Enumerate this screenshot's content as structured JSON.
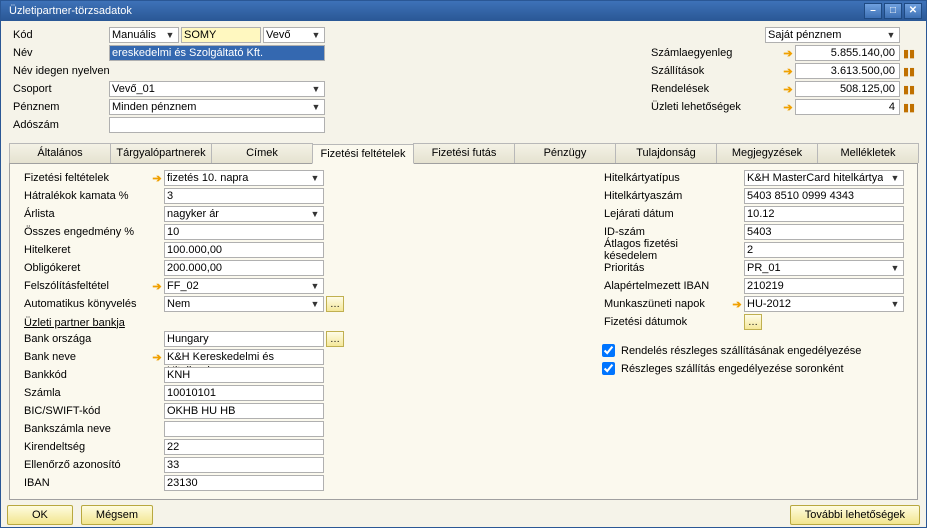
{
  "window": {
    "title": "Üzletipartner-törzsadatok"
  },
  "header": {
    "kod_label": "Kód",
    "kod_mode": "Manuális",
    "kod_value": "SOMY",
    "partner_type": "Vevő",
    "nev_label": "Név",
    "nev_value": "ereskedelmi és Szolgáltató Kft.",
    "nev_idegen_label": "Név idegen nyelven",
    "nev_idegen_value": "",
    "csoport_label": "Csoport",
    "csoport_value": "Vevő_01",
    "penznem_label": "Pénznem",
    "penznem_value": "Minden pénznem",
    "adoszam_label": "Adószám",
    "adoszam_value": ""
  },
  "summary": {
    "currency": "Saját pénznem",
    "egyenleg_label": "Számlaegyenleg",
    "egyenleg": "5.855.140,00",
    "szallitasok_label": "Szállítások",
    "szallitasok": "3.613.500,00",
    "rendelesek_label": "Rendelések",
    "rendelesek": "508.125,00",
    "uzleti_label": "Üzleti lehetőségek",
    "uzleti": "4"
  },
  "tabs": {
    "altalanos": "Általános",
    "targyalopartnerek": "Tárgyalópartnerek",
    "cimek": "Címek",
    "fizetesi_feltetelek": "Fizetési feltételek",
    "fizetesi_futas": "Fizetési futás",
    "penzugy": "Pénzügy",
    "tulajdonsag": "Tulajdonság",
    "megjegyzesek": "Megjegyzések",
    "mellekletek": "Mellékletek"
  },
  "left": {
    "fizetesi_feltetelek_label": "Fizetési feltételek",
    "fizetesi_feltetelek": "fizetés 10. napra",
    "hatralekokkamata_label": "Hátralékok kamata %",
    "hatralekokkamata": "3",
    "arlista_label": "Árlista",
    "arlista": "nagyker ár",
    "osszes_engedmenyes_label": "Összes engedmény %",
    "osszes_engedmenyes": "10",
    "hitelkeret_label": "Hitelkeret",
    "hitelkeret": "100.000,00",
    "obligokeret_label": "Obligókeret",
    "obligokeret": "200.000,00",
    "felszolitasfeltetel_label": "Felszólításfeltétel",
    "felszolitasfeltetel": "FF_02",
    "auto_konyveles_label": "Automatikus könyvelés",
    "auto_konyveles": "Nem",
    "section_bank": "Üzleti partner bankja",
    "bank_orszaga_label": "Bank országa",
    "bank_orszaga": "Hungary",
    "bank_neve_label": "Bank neve",
    "bank_neve": "K&H Kereskedelmi és Hitelbank",
    "bankkod_label": "Bankkód",
    "bankkod": "KNH",
    "szamla_label": "Számla",
    "szamla": "10010101",
    "bic_label": "BIC/SWIFT-kód",
    "bic": "OKHB HU HB",
    "bankszamla_neve_label": "Bankszámla neve",
    "bankszamla_neve": "",
    "kirendeltseg_label": "Kirendeltség",
    "kirendeltseg": "22",
    "ellenorzo_label": "Ellenőrző azonosító",
    "ellenorzo": "33",
    "iban_label": "IBAN",
    "iban": "23130"
  },
  "right": {
    "hitelkartyatipus_label": "Hitelkártyatípus",
    "hitelkartyatipus": "K&H MasterCard hitelkártya",
    "hitelkartyaszam_label": "Hitelkártyaszám",
    "hitelkartyaszam": "5403 8510 0999 4343",
    "lejarati_label": "Lejárati dátum",
    "lejarati": "10.12",
    "idszam_label": "ID-szám",
    "idszam": "5403",
    "atlagos_label": "Átlagos fizetési késedelem",
    "atlagos": "2",
    "prioritas_label": "Prioritás",
    "prioritas": "PR_01",
    "alap_iban_label": "Alapértelmezett IBAN",
    "alap_iban": "210219",
    "munkaszuneti_label": "Munkaszüneti napok",
    "munkaszuneti": "HU-2012",
    "fizetesi_datumok_label": "Fizetési dátumok",
    "cb1": "Rendelés részleges szállításának engedélyezése",
    "cb2": "Részleges szállítás engedélyezése soronként"
  },
  "footer": {
    "ok": "OK",
    "megsem": "Mégsem",
    "tovabbi": "További lehetőségek"
  }
}
